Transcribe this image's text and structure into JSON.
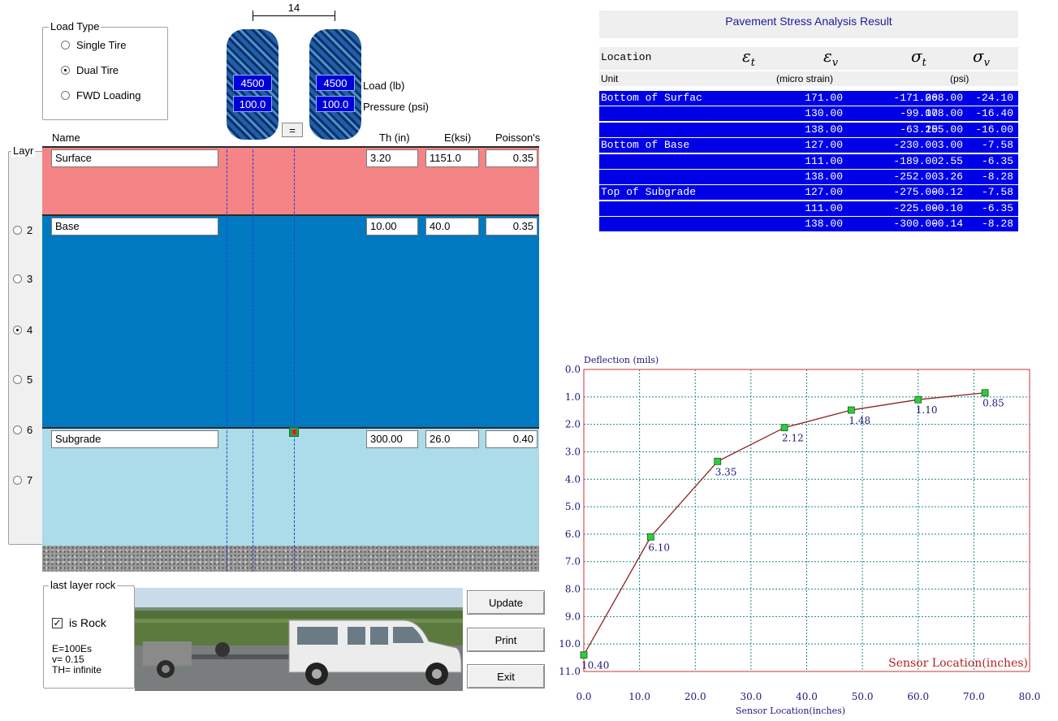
{
  "load_type": {
    "legend": "Load Type",
    "options": [
      "Single Tire",
      "Dual Tire",
      "FWD Loading"
    ],
    "selected": "Dual Tire"
  },
  "tires": {
    "spacing_label": "14",
    "left_load": "4500",
    "left_pressure": "100.0",
    "right_load": "4500",
    "right_pressure": "100.0",
    "equal_button": "=",
    "load_label": "Load (lb)",
    "pressure_label": "Pressure (psi)"
  },
  "layer_headers": {
    "name": "Name",
    "th": "Th (in)",
    "e": "E(ksi)",
    "poisson": "Poisson's"
  },
  "layer_count": {
    "legend": "Layr",
    "options": [
      "2",
      "3",
      "4",
      "5",
      "6",
      "7"
    ],
    "selected": "4"
  },
  "layers": [
    {
      "name": "Surface",
      "th": "3.20",
      "e": "1151.0",
      "poisson": "0.35",
      "color": "#f48485"
    },
    {
      "name": "Base",
      "th": "10.00",
      "e": "40.0",
      "poisson": "0.35",
      "color": "#0079c0"
    },
    {
      "name": "Subgrade",
      "th": "300.00",
      "e": "26.0",
      "poisson": "0.40",
      "color": "#acdbe9"
    }
  ],
  "rock": {
    "legend": "last layer rock",
    "checkbox_label": "is Rock",
    "checked": true,
    "check_glyph": "✓",
    "line1": "E=100Es",
    "line2": "v=  0.15",
    "line3": "TH= infinite"
  },
  "buttons": {
    "update": "Update",
    "print": "Print",
    "exit": "Exit"
  },
  "results": {
    "title": "Pavement Stress Analysis Result",
    "header_location": "Location",
    "sym1": "ε",
    "sym1_sub": "t",
    "sym2": "ε",
    "sym2_sub": "v",
    "sym3": "σ",
    "sym3_sub": "t",
    "sym4": "σ",
    "sym4_sub": "v",
    "unit_label": "Unit",
    "unit_strain": "(micro strain)",
    "unit_stress": "(psi)",
    "rows": [
      {
        "loc": "Bottom of Surfac",
        "et": "171.00",
        "ev": "-171.00",
        "st": "268.00",
        "sv": "-24.10"
      },
      {
        "loc": "",
        "et": "130.00",
        "ev": "-99.00",
        "st": "178.00",
        "sv": "-16.40"
      },
      {
        "loc": "",
        "et": "138.00",
        "ev": "-63.20",
        "st": "155.00",
        "sv": "-16.00"
      },
      {
        "loc": "Bottom of Base",
        "et": "127.00",
        "ev": "-230.00",
        "st": "3.00",
        "sv": "-7.58"
      },
      {
        "loc": "",
        "et": "111.00",
        "ev": "-189.00",
        "st": "2.55",
        "sv": "-6.35"
      },
      {
        "loc": "",
        "et": "138.00",
        "ev": "-252.00",
        "st": "3.26",
        "sv": "-8.28"
      },
      {
        "loc": "Top of Subgrade",
        "et": "127.00",
        "ev": "-275.00",
        "st": "-0.12",
        "sv": "-7.58"
      },
      {
        "loc": "",
        "et": "111.00",
        "ev": "-225.00",
        "st": "-0.10",
        "sv": "-6.35"
      },
      {
        "loc": "",
        "et": "138.00",
        "ev": "-300.00",
        "st": "-0.14",
        "sv": "-8.28"
      }
    ]
  },
  "chart_data": {
    "type": "line",
    "ylabel": "Deflection (mils)",
    "xlabel": "Sensor Location(inches)",
    "inner_xlabel": "Sensor Location(inches)",
    "x": [
      0,
      12,
      24,
      36,
      48,
      60,
      72
    ],
    "y": [
      10.4,
      6.1,
      3.35,
      2.12,
      1.48,
      1.1,
      0.85
    ],
    "point_labels": [
      "10.40",
      "6.10",
      "3.35",
      "2.12",
      "1.48",
      "1.10",
      "0.85"
    ],
    "xlim": [
      0,
      80
    ],
    "ylim": [
      0,
      11
    ],
    "y_inverted": true,
    "grid": true,
    "xticks": [
      "0.0",
      "10.0",
      "20.0",
      "30.0",
      "40.0",
      "50.0",
      "60.0",
      "70.0",
      "80.0"
    ],
    "yticks": [
      "0.0",
      "1.0",
      "2.0",
      "3.0",
      "4.0",
      "5.0",
      "6.0",
      "7.0",
      "8.0",
      "9.0",
      "10.0",
      "11.0"
    ],
    "line_color": "#8b2323",
    "marker_color": "#2ecc40",
    "frame_color": "#cc3333",
    "grid_color": "#1a8a8a"
  }
}
